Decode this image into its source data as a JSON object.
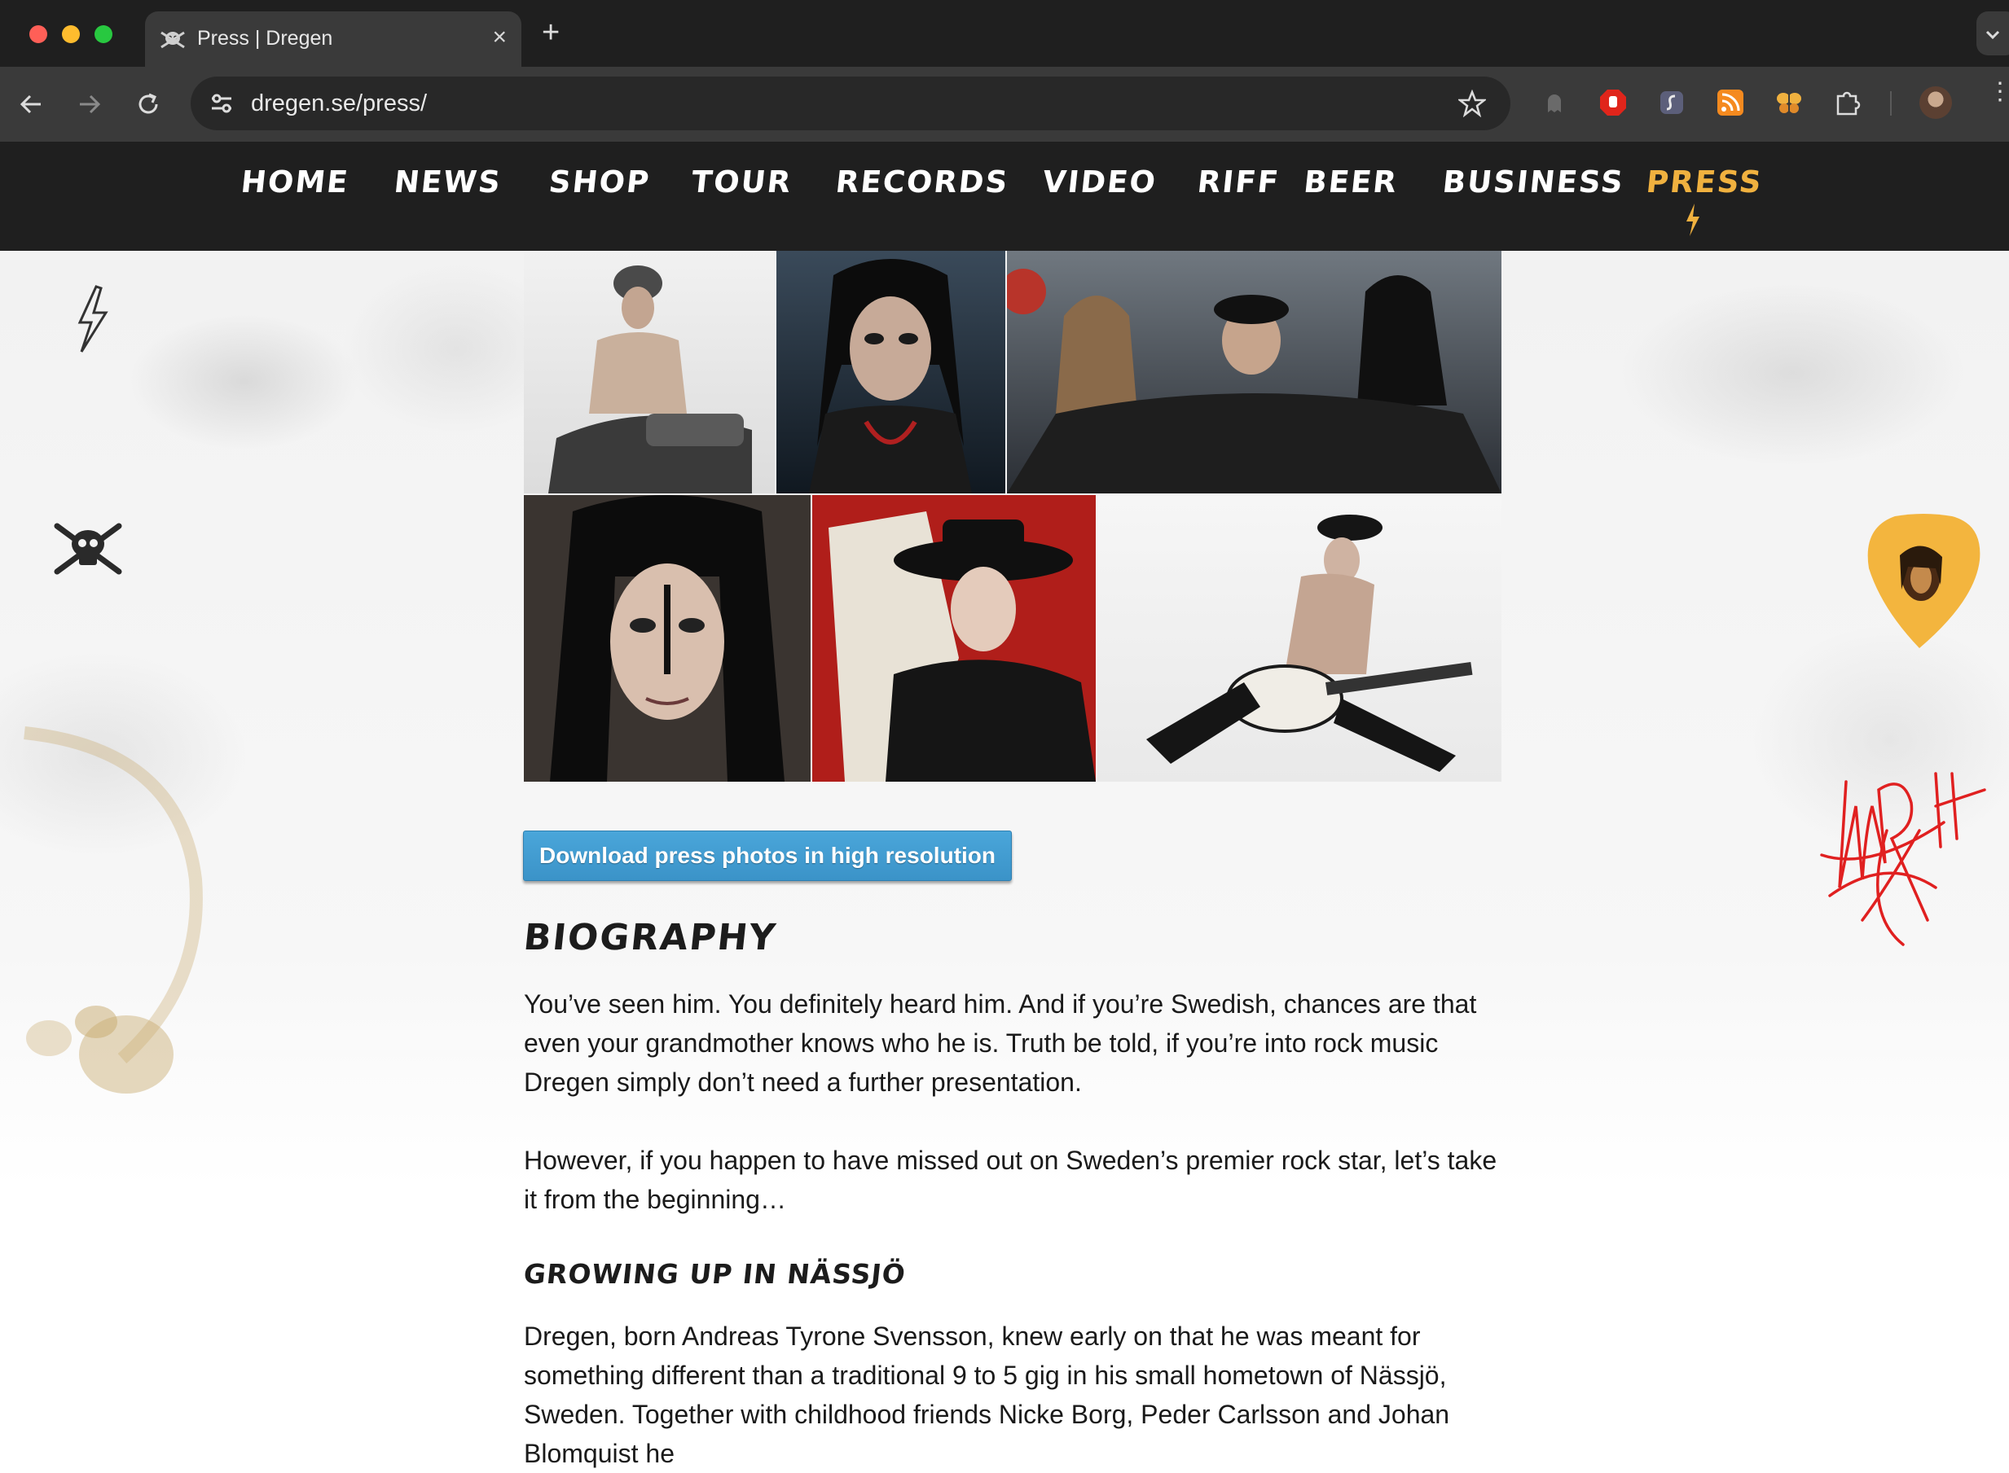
{
  "browser": {
    "tab_title": "Press | Dregen",
    "url": "dregen.se/press/"
  },
  "site_nav": {
    "items": [
      {
        "label": "HOME"
      },
      {
        "label": "NEWS"
      },
      {
        "label": "SHOP"
      },
      {
        "label": "TOUR"
      },
      {
        "label": "RECORDS"
      },
      {
        "label": "VIDEO"
      },
      {
        "label": "RIFF  BEER"
      },
      {
        "label": "BUSINESS"
      },
      {
        "label": "PRESS",
        "active": true
      }
    ]
  },
  "colors": {
    "nav_active": "#f0b13f",
    "button": "#3b93c8",
    "signature": "#e02020",
    "nav_background": "#1f1f1f"
  },
  "icons": [
    "back-arrow-icon",
    "forward-arrow-icon",
    "reload-icon",
    "site-settings-icon",
    "bookmark-star-icon",
    "extension-puzzle-icon",
    "lightning-bolt-icon",
    "skull-crossbones-icon",
    "guitar-pick-icon",
    "coffee-stain-icon"
  ],
  "main": {
    "download_button": "Download press photos in high resolution",
    "biography_heading": "BIOGRAPHY",
    "bio_paragraph_1": "You’ve seen him. You definitely heard him. And if you’re Swedish, chances are that even your grandmother knows who he is. Truth be told, if you’re into rock music Dregen simply don’t need a further presentation.",
    "bio_paragraph_2": "However, if you happen to have missed out on Sweden’s premier rock star, let’s take it from the beginning…",
    "growing_up_heading": "GROWING UP IN NÄSSJÖ",
    "growing_up_paragraph": "Dregen, born Andreas Tyrone Svensson, knew early on that he was meant for something different than a traditional 9 to 5 gig in his small hometown of Nässjö, Sweden. Together with childhood friends Nicke Borg, Peder Carlsson and Johan Blomquist he"
  }
}
